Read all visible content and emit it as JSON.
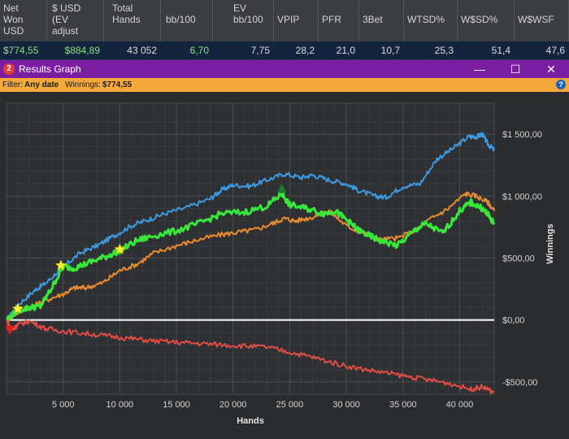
{
  "stats": {
    "headers": [
      "Net Won USD",
      "$ USD (EV adjust",
      "Total Hands",
      "bb/100",
      "EV bb/100",
      "VPIP",
      "PFR",
      "3Bet",
      "WTSD%",
      "W$SD%",
      "W$WSF"
    ],
    "header_lines": [
      [
        "Net",
        "Won",
        "USD"
      ],
      [
        "$ USD",
        "(EV",
        "adjust"
      ],
      [
        "Total",
        "Hands"
      ],
      [
        "bb/100"
      ],
      [
        "EV",
        "bb/100"
      ],
      [
        "VPIP"
      ],
      [
        "PFR"
      ],
      [
        "3Bet"
      ],
      [
        "WTSD%"
      ],
      [
        "W$SD%"
      ],
      [
        "W$WSF"
      ]
    ],
    "values": [
      "$774,55",
      "$884,89",
      "43 052",
      "6,70",
      "7,75",
      "28,2",
      "21,0",
      "10,7",
      "25,3",
      "51,4",
      "47,6"
    ]
  },
  "window": {
    "icon_text": "2",
    "title": "Results Graph",
    "minimize": "—",
    "maximize": "☐",
    "close": "✕"
  },
  "filter": {
    "prefix": "Filter:",
    "date": "Any date",
    "winnings_label": "Winnings:",
    "winnings_value": "$774,55",
    "help": "?"
  },
  "colors": {
    "net": "#37e83a",
    "allin_ev": "#3d9ae0",
    "showdown": "#e88a2e",
    "non_showdown": "#e24c44",
    "zero_line": "#ffffff"
  },
  "chart_data": {
    "type": "line",
    "xlabel": "Hands",
    "ylabel": "Winnings",
    "xlim": [
      0,
      43052
    ],
    "ylim": [
      -600,
      1750
    ],
    "x_ticks": [
      5000,
      10000,
      15000,
      20000,
      25000,
      30000,
      35000,
      40000
    ],
    "x_tick_labels": [
      "5 000",
      "10 000",
      "15 000",
      "20 000",
      "25 000",
      "30 000",
      "35 000",
      "40 000"
    ],
    "y_ticks": [
      1500,
      1000,
      500,
      0,
      -500
    ],
    "y_tick_labels": [
      "$1 500,00",
      "$1 000,00",
      "$500,00",
      "$0,00",
      "-$500,00"
    ],
    "series": [
      {
        "key": "allin_ev",
        "x": [
          0,
          1000,
          2500,
          3500,
          5000,
          6500,
          8000,
          9500,
          11000,
          12500,
          14000,
          16000,
          18000,
          19000,
          20000,
          21500,
          23000,
          24500,
          26000,
          27000,
          28500,
          30000,
          31000,
          32500,
          33500,
          35000,
          36500,
          38000,
          39500,
          40800,
          41500,
          42000,
          42500,
          43052
        ],
        "y": [
          0,
          120,
          240,
          300,
          430,
          540,
          600,
          680,
          760,
          810,
          860,
          910,
          980,
          1050,
          1090,
          1080,
          1130,
          1180,
          1150,
          1170,
          1130,
          1100,
          1050,
          1000,
          990,
          1080,
          1100,
          1300,
          1390,
          1480,
          1480,
          1500,
          1420,
          1370
        ]
      },
      {
        "key": "showdown",
        "x": [
          0,
          1000,
          2500,
          3500,
          5000,
          6000,
          7000,
          8500,
          10000,
          11500,
          13000,
          15000,
          17000,
          19000,
          20500,
          22000,
          23500,
          24500,
          25500,
          27000,
          28500,
          30000,
          31500,
          33000,
          34500,
          36000,
          37500,
          39000,
          40500,
          41500,
          42500,
          43052
        ],
        "y": [
          0,
          60,
          120,
          160,
          210,
          260,
          260,
          300,
          400,
          450,
          540,
          600,
          650,
          690,
          710,
          730,
          780,
          820,
          800,
          830,
          880,
          760,
          700,
          650,
          660,
          720,
          820,
          900,
          1020,
          1000,
          950,
          880
        ]
      },
      {
        "key": "net",
        "x": [
          0,
          1000,
          2000,
          3000,
          4000,
          5000,
          6000,
          7500,
          9000,
          10000,
          11500,
          13000,
          15000,
          17000,
          19000,
          21000,
          23000,
          24300,
          25000,
          26500,
          28000,
          29000,
          30000,
          31000,
          32000,
          33000,
          34500,
          36000,
          37000,
          38500,
          40000,
          41000,
          42000,
          42500,
          43052
        ],
        "y": [
          0,
          80,
          100,
          110,
          260,
          430,
          420,
          470,
          520,
          560,
          640,
          680,
          720,
          780,
          860,
          870,
          920,
          1020,
          930,
          900,
          860,
          880,
          810,
          730,
          680,
          640,
          600,
          720,
          780,
          700,
          880,
          950,
          900,
          850,
          774
        ]
      },
      {
        "key": "non_showdown",
        "x": [
          0,
          500,
          1000,
          2000,
          3500,
          5000,
          7000,
          9000,
          11000,
          13000,
          15000,
          17000,
          19000,
          21000,
          23000,
          25000,
          27000,
          29000,
          31000,
          33000,
          35000,
          37000,
          39000,
          41000,
          42000,
          43052
        ],
        "y": [
          0,
          -80,
          -40,
          -10,
          -70,
          -90,
          -110,
          -130,
          -150,
          -170,
          -180,
          -190,
          -200,
          -210,
          -220,
          -260,
          -300,
          -350,
          -390,
          -420,
          -450,
          -480,
          -510,
          -560,
          -540,
          -585
        ]
      }
    ],
    "markers": [
      {
        "type": "down-triangle",
        "color": "#e02020",
        "x": 300,
        "y": -80
      },
      {
        "type": "star",
        "color": "#f6f02e",
        "x": 1000,
        "y": 90
      },
      {
        "type": "star",
        "color": "#f6f02e",
        "x": 4800,
        "y": 440
      },
      {
        "type": "star",
        "color": "#f6f02e",
        "x": 10000,
        "y": 570
      },
      {
        "type": "up-triangle",
        "color": "#1e7a28",
        "x": 24300,
        "y": 1060
      }
    ]
  }
}
